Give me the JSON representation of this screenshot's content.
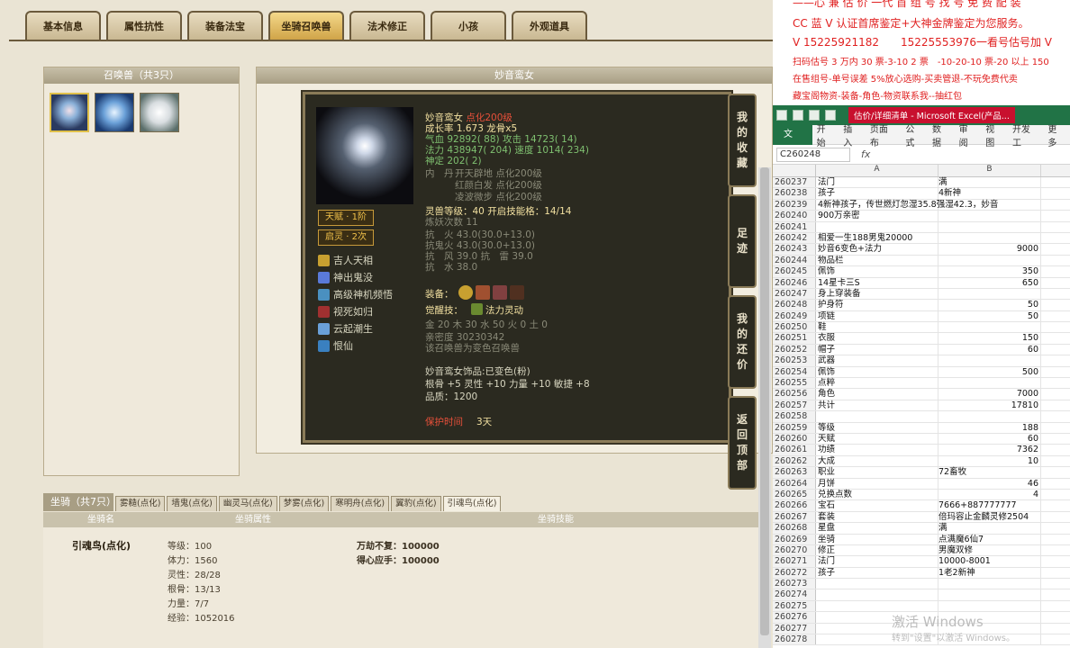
{
  "tabs": [
    "基本信息",
    "属性抗性",
    "装备法宝",
    "坐骑召唤兽",
    "法术修正",
    "小孩",
    "外观道具"
  ],
  "active_tab": 3,
  "summon_panel": {
    "title": "召唤兽（共3只）"
  },
  "detail_panel": {
    "title": "妙音鸾女"
  },
  "card": {
    "name": "妙音鸾女",
    "name_suffix": "点化200级",
    "growth": "成长率 1.673  龙骨x5",
    "qixue": "气血 92892( 88) 攻击 14723( 14)",
    "fali": "法力 438947( 204) 速度 1014( 234)",
    "shending": "神定 202( 2)",
    "neidan_label": "内　丹",
    "neidan": [
      "开天辟地 点化200级",
      "红颜白发 点化200级",
      "凌波微步 点化200级"
    ],
    "lingshou": "灵兽等级：40  开启技能格：14/14",
    "lianyao": "炼妖次数 11",
    "kang1": "抗　火 43.0(30.0+13.0)",
    "kang2": "抗鬼火 43.0(30.0+13.0)",
    "kang3": "抗　风 39.0 抗　雷 39.0",
    "kang4": "抗　水 38.0",
    "equip_label": "装备：",
    "awaken_label": "觉醒技：",
    "awaken": "法力灵动",
    "wuxing": "金 20 木 30 水 50 火 0 土 0",
    "qinmi": "亲密度 30230342",
    "bianse": "该召唤兽为变色召唤兽",
    "shipin": "妙音鸾女饰品:已变色(粉)",
    "shipin_attr": "根骨 +5 灵性 +10 力量 +10 敏捷 +8",
    "pinzhi": "品质：1200",
    "protect_label": "保护时间",
    "protect_val": "3天",
    "badge1": "天赋 · 1阶",
    "badge2": "启灵 · 2次",
    "skills": [
      "吉人天相",
      "神出鬼没",
      "高级神机频悟",
      "视死如归",
      "云起潮生",
      "恨仙"
    ]
  },
  "side_buttons": [
    "我的收藏",
    "足迹",
    "我的还价",
    "返回顶部"
  ],
  "mount": {
    "label": "坐骑（共7只）",
    "tabs": [
      "雾糙(点化)",
      "墙鬼(点化)",
      "幽灵马(点化)",
      "梦雾(点化)",
      "寒明舟(点化)",
      "翼豹(点化)",
      "引魂鸟(点化)"
    ],
    "active": 6,
    "headers": [
      "坐骑名",
      "坐骑属性",
      "坐骑技能"
    ],
    "name": "引魂鸟(点化)",
    "attrs": [
      "等级：100",
      "体力：1560",
      "灵性：28/28",
      "根骨：13/13",
      "力量：7/7",
      "经验：1052016"
    ],
    "techs": [
      "万劫不复：100000",
      "得心应手：100000"
    ]
  },
  "doc_lines": [
    "——心 兼 估 价 一代 首 组 号 找 号 免 费 配 装",
    "CC 蓝 V 认证首席鉴定+大神金牌鉴定为您服务。",
    "V 15225921182　　15225553976一看号估号加 V",
    "扫码估号 3 万内 30 票-3-10 2 票　-10-20-10 票-20 以上 150",
    "在售组号-单号误差 5%放心选购-买卖管退-不玩免费代卖",
    "藏宝阁物资-装备-角色-物资联系我--抽红包"
  ],
  "excel": {
    "title": "估价/详细清单 - Microsoft Excel(产品...",
    "ribbon": [
      "文件",
      "开始",
      "插入",
      "页面布",
      "公式",
      "数据",
      "审阅",
      "视图",
      "开发工",
      "更多"
    ],
    "namebox": "C260248",
    "fx": "fx",
    "cols": [
      "A",
      "B"
    ],
    "rows": [
      [
        "260237",
        "法门",
        "满",
        false
      ],
      [
        "260238",
        "孩子",
        "4新神",
        false
      ],
      [
        "260239",
        "4新神孩子，传世燃灯忽湿35.8强湿42.3，妙音",
        "",
        false
      ],
      [
        "260240",
        "900万亲密",
        "",
        false
      ],
      [
        "260241",
        "",
        "",
        false
      ],
      [
        "260242",
        "相爱一生188男鬼20000",
        "",
        false
      ],
      [
        "260243",
        "妙音6变色+法力",
        "9000",
        true
      ],
      [
        "260244",
        "物品栏",
        "",
        false
      ],
      [
        "260245",
        "佩饰",
        "350",
        true
      ],
      [
        "260246",
        "14星卡三S",
        "650",
        true
      ],
      [
        "260247",
        "身上穿装备",
        "",
        false
      ],
      [
        "260248",
        "护身符",
        "50",
        true
      ],
      [
        "260249",
        "项链",
        "50",
        true
      ],
      [
        "260250",
        "鞋",
        "",
        false
      ],
      [
        "260251",
        "衣服",
        "150",
        true
      ],
      [
        "260252",
        "帽子",
        "60",
        true
      ],
      [
        "260253",
        "武器",
        "",
        false
      ],
      [
        "260254",
        "佩饰",
        "500",
        true
      ],
      [
        "260255",
        "点粹",
        "",
        false
      ],
      [
        "260256",
        "角色",
        "7000",
        true
      ],
      [
        "260257",
        "共计",
        "17810",
        true
      ],
      [
        "260258",
        "",
        "",
        false
      ],
      [
        "260259",
        "等级",
        "188",
        true
      ],
      [
        "260260",
        "天赋",
        "60",
        true
      ],
      [
        "260261",
        "功绩",
        "7362",
        true
      ],
      [
        "260262",
        "大成",
        "10",
        true
      ],
      [
        "260263",
        "职业",
        "72畜牧",
        false
      ],
      [
        "260264",
        "月饼",
        "46",
        true
      ],
      [
        "260265",
        "兑换点数",
        "4",
        true
      ],
      [
        "260266",
        "宝石",
        "7666+887777777",
        false
      ],
      [
        "260267",
        "套装",
        "倍玛容止金麟灵修2504",
        false
      ],
      [
        "260268",
        "星盘",
        "满",
        false
      ],
      [
        "260269",
        "坐骑",
        "点满魔6仙7",
        false
      ],
      [
        "260270",
        "修正",
        "男魔双修",
        false
      ],
      [
        "260271",
        "法门",
        "10000-8001",
        false
      ],
      [
        "260272",
        "孩子",
        "1老2新神",
        false
      ],
      [
        "260273",
        "",
        "",
        false
      ],
      [
        "260274",
        "",
        "",
        false
      ],
      [
        "260275",
        "",
        "",
        false
      ],
      [
        "260276",
        "",
        "",
        false
      ],
      [
        "260277",
        "",
        "",
        false
      ],
      [
        "260278",
        "",
        "",
        false
      ]
    ]
  },
  "watermark": "激活 Windows",
  "watermark2": "转到\"设置\"以激活 Windows。"
}
